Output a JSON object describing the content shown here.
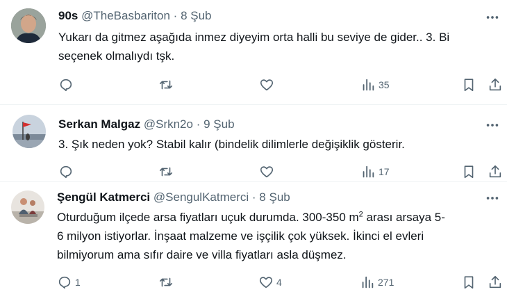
{
  "tweets": [
    {
      "name": "90s",
      "handle": "@TheBasbariton",
      "dot": "·",
      "date": "8 Şub",
      "text_lines": [
        "Yukarı da gitmez aşağıda inmez diyeyim orta halli bu seviye de gider.. 3. Bi",
        "seçenek olmalıydı tşk."
      ],
      "reply_count": "",
      "retweet_count": "",
      "like_count": "",
      "view_count": "35"
    },
    {
      "name": "Serkan Malgaz",
      "handle": "@Srkn2o",
      "dot": "·",
      "date": "9 Şub",
      "text_lines": [
        "3. Şık neden yok? Stabil kalır (bindelik dilimlerle değişiklik gösterir."
      ],
      "reply_count": "",
      "retweet_count": "",
      "like_count": "",
      "view_count": "17"
    },
    {
      "name": "Şengül Katmerci",
      "handle": "@SengulKatmerci",
      "dot": "·",
      "date": "8 Şub",
      "text_line1_pre": "Oturduğum ilçede arsa fiyatları uçuk durumda. 300-350 m",
      "text_line1_sup": "2",
      "text_line1_post": " arası arsaya 5-",
      "text_lines_rest": [
        "6 milyon istiyorlar. İnşaat malzeme ve işçilik çok yüksek. İkinci el evleri",
        "bilmiyorum ama sıfır daire ve villa fiyatları asla düşmez."
      ],
      "reply_count": "1",
      "retweet_count": "",
      "like_count": "4",
      "view_count": "271"
    }
  ],
  "icons": [
    "more-icon",
    "reply-icon",
    "retweet-icon",
    "like-icon",
    "views-icon",
    "bookmark-icon",
    "share-icon"
  ],
  "colors": {
    "text": "#0f1419",
    "secondary": "#536471",
    "divider": "#eff3f4"
  }
}
